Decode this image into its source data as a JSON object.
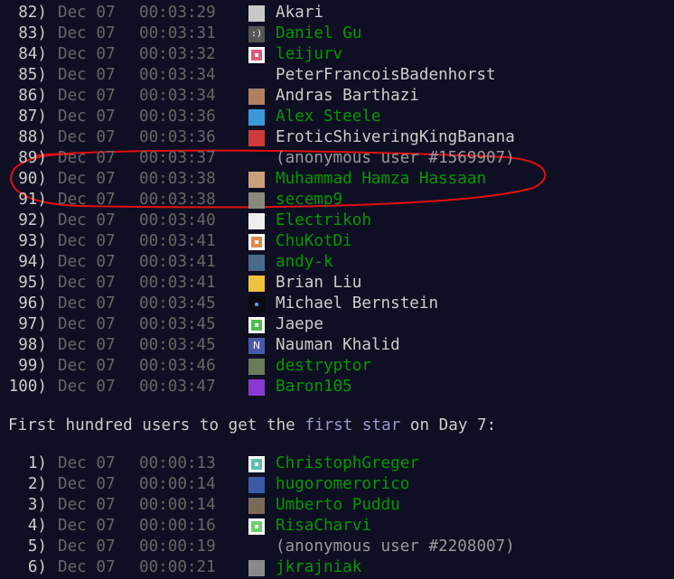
{
  "section_heading": {
    "prefix": "First hundred users to get the ",
    "highlight": "first star",
    "suffix": " on Day 7:"
  },
  "both_stars_rows": [
    {
      "rank": "82)",
      "date": "Dec 07",
      "time": "00:03:29",
      "name": "Akari",
      "style": "plain",
      "avatar": "anime-face-avatar",
      "avatar_color": "#c8c8c8"
    },
    {
      "rank": "83)",
      "date": "Dec 07",
      "time": "00:03:31",
      "name": "Daniel Gu",
      "style": "link",
      "avatar": "smiley-avatar",
      "avatar_color": "#555555"
    },
    {
      "rank": "84)",
      "date": "Dec 07",
      "time": "00:03:32",
      "name": "leijurv",
      "style": "link",
      "avatar": "pink-identicon-avatar",
      "avatar_color": "#e05a7a"
    },
    {
      "rank": "85)",
      "date": "Dec 07",
      "time": "00:03:34",
      "name": "PeterFrancoisBadenhorst",
      "style": "plain",
      "avatar": "none",
      "avatar_color": ""
    },
    {
      "rank": "86)",
      "date": "Dec 07",
      "time": "00:03:34",
      "name": "Andras Barthazi",
      "style": "plain",
      "avatar": "photo-avatar",
      "avatar_color": "#b08060"
    },
    {
      "rank": "87)",
      "date": "Dec 07",
      "time": "00:03:36",
      "name": "Alex Steele",
      "style": "link",
      "avatar": "atom-avatar",
      "avatar_color": "#3a9ad9"
    },
    {
      "rank": "88)",
      "date": "Dec 07",
      "time": "00:03:36",
      "name": "EroticShiveringKingBanana",
      "style": "plain",
      "avatar": "red-face-avatar",
      "avatar_color": "#d03a3a"
    },
    {
      "rank": "89)",
      "date": "Dec 07",
      "time": "00:03:37",
      "name": "(anonymous user #1569907)",
      "style": "anon",
      "avatar": "none",
      "avatar_color": ""
    },
    {
      "rank": "90)",
      "date": "Dec 07",
      "time": "00:03:38",
      "name": "Muhammad Hamza Hassaan",
      "style": "link",
      "avatar": "photo-avatar",
      "avatar_color": "#c9a07a"
    },
    {
      "rank": "91)",
      "date": "Dec 07",
      "time": "00:03:38",
      "name": "secemp9",
      "style": "link",
      "avatar": "photo-avatar",
      "avatar_color": "#8a8a7a"
    },
    {
      "rank": "92)",
      "date": "Dec 07",
      "time": "00:03:40",
      "name": "Electrikoh",
      "style": "link",
      "avatar": "white-card-avatar",
      "avatar_color": "#eeeeee"
    },
    {
      "rank": "93)",
      "date": "Dec 07",
      "time": "00:03:41",
      "name": "ChuKotDi",
      "style": "link",
      "avatar": "orange-identicon-avatar",
      "avatar_color": "#e08a4a"
    },
    {
      "rank": "94)",
      "date": "Dec 07",
      "time": "00:03:41",
      "name": "andy-k",
      "style": "link",
      "avatar": "photo-avatar",
      "avatar_color": "#4a6a8a"
    },
    {
      "rank": "95)",
      "date": "Dec 07",
      "time": "00:03:41",
      "name": "Brian Liu",
      "style": "plain",
      "avatar": "cartoon-avatar",
      "avatar_color": "#f0c040"
    },
    {
      "rank": "96)",
      "date": "Dec 07",
      "time": "00:03:45",
      "name": "Michael Bernstein",
      "style": "plain",
      "avatar": "dark-dot-avatar",
      "avatar_color": "#1a2a3a"
    },
    {
      "rank": "97)",
      "date": "Dec 07",
      "time": "00:03:45",
      "name": "Jaepe",
      "style": "plain",
      "avatar": "green-identicon-avatar",
      "avatar_color": "#4ac04a"
    },
    {
      "rank": "98)",
      "date": "Dec 07",
      "time": "00:03:45",
      "name": "Nauman Khalid",
      "style": "plain",
      "avatar": "letter-n-avatar",
      "avatar_color": "#4a5aa8"
    },
    {
      "rank": "99)",
      "date": "Dec 07",
      "time": "00:03:46",
      "name": "destryptor",
      "style": "link",
      "avatar": "photo-avatar",
      "avatar_color": "#6a7a5a"
    },
    {
      "rank": "100)",
      "date": "Dec 07",
      "time": "00:03:47",
      "name": "Baron105",
      "style": "link",
      "avatar": "purple-monster-avatar",
      "avatar_color": "#8a3ad0"
    }
  ],
  "first_star_rows": [
    {
      "rank": "1)",
      "date": "Dec 07",
      "time": "00:00:13",
      "name": "ChristophGreger",
      "style": "link",
      "avatar": "teal-identicon-avatar",
      "avatar_color": "#5ac0b0"
    },
    {
      "rank": "2)",
      "date": "Dec 07",
      "time": "00:00:14",
      "name": "hugoromerorico",
      "style": "link",
      "avatar": "photo-avatar",
      "avatar_color": "#3a5aa8"
    },
    {
      "rank": "3)",
      "date": "Dec 07",
      "time": "00:00:14",
      "name": "Umberto Puddu",
      "style": "link",
      "avatar": "photo-avatar",
      "avatar_color": "#7a6a5a"
    },
    {
      "rank": "4)",
      "date": "Dec 07",
      "time": "00:00:16",
      "name": "RisaCharvi",
      "style": "link",
      "avatar": "green-identicon-avatar",
      "avatar_color": "#6ad06a"
    },
    {
      "rank": "5)",
      "date": "Dec 07",
      "time": "00:00:19",
      "name": "(anonymous user #2208007)",
      "style": "anon",
      "avatar": "none",
      "avatar_color": ""
    },
    {
      "rank": "6)",
      "date": "Dec 07",
      "time": "00:00:21",
      "name": "jkrajniak",
      "style": "link",
      "avatar": "photo-avatar",
      "avatar_color": "#8a8a8a"
    }
  ],
  "colors": {
    "background": "#0f0f23",
    "text": "#cccccc",
    "muted": "#666666",
    "link": "#009900",
    "anonymous": "#999999",
    "highlight": "#9999cc",
    "annotation": "#e01010"
  },
  "annotation": {
    "type": "hand-drawn-ellipse",
    "highlighted_rows": [
      "89)",
      "90)",
      "91)"
    ]
  }
}
